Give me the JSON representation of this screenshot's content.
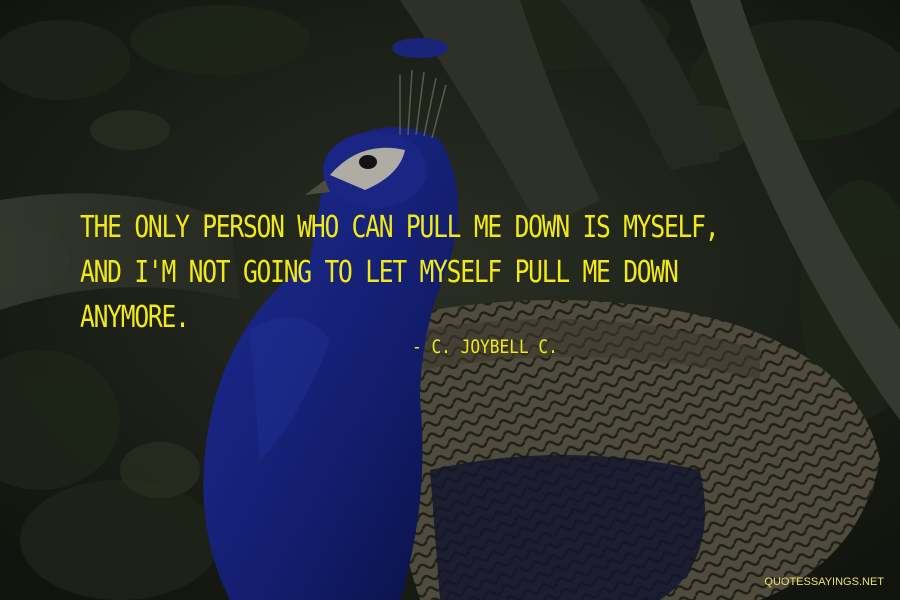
{
  "quote": {
    "lines": [
      "THE ONLY PERSON WHO CAN PULL ME DOWN IS MYSELF,",
      "AND I'M NOT GOING TO LET MYSELF PULL ME DOWN",
      "ANYMORE."
    ],
    "author": "- C. JOYBELL C."
  },
  "watermark": "QUOTESSAYINGS.NET",
  "colors": {
    "text": "#f1ea17",
    "peacock_blue": "#1e2fb0",
    "foliage_dark": "#1e2419"
  },
  "image": {
    "subject": "peacock"
  }
}
